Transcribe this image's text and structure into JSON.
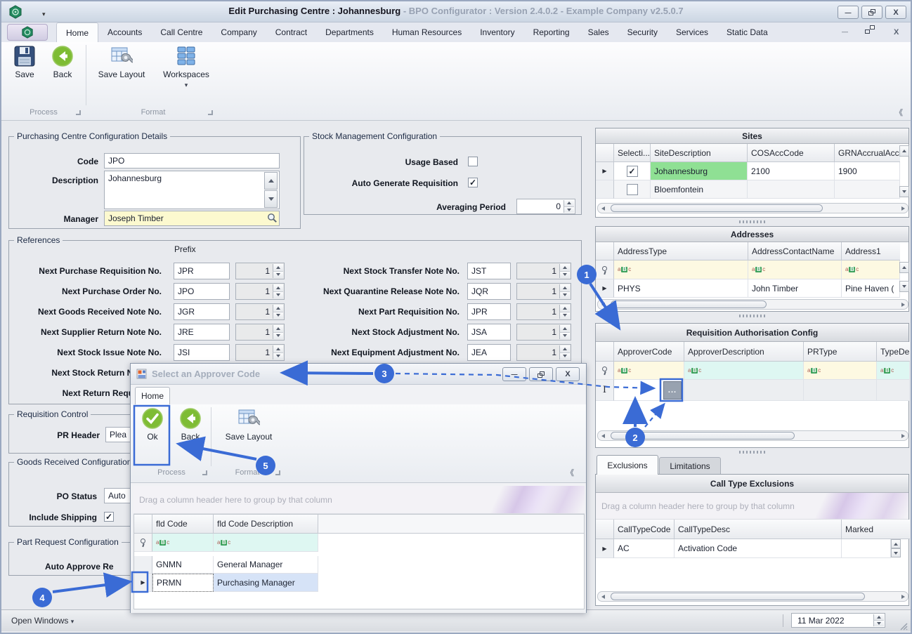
{
  "window": {
    "title": "Edit Purchasing Centre : Johannesburg",
    "subtitle": " - BPO Configurator : Version 2.4.0.2 - Example Company v2.5.0.7"
  },
  "ribbon": {
    "tabs": [
      "Home",
      "Accounts",
      "Call Centre",
      "Company",
      "Contract",
      "Departments",
      "Human Resources",
      "Inventory",
      "Reporting",
      "Sales",
      "Security",
      "Services",
      "Static Data"
    ],
    "save": "Save",
    "back": "Back",
    "save_layout": "Save Layout",
    "workspaces": "Workspaces",
    "group_process": "Process",
    "group_format": "Format"
  },
  "form": {
    "pcc": {
      "title": "Purchasing Centre Configuration Details",
      "code_label": "Code",
      "code": "JPO",
      "desc_label": "Description",
      "desc": "Johannesburg",
      "manager_label": "Manager",
      "manager": "Joseph Timber"
    },
    "stock": {
      "title": "Stock Management Configuration",
      "usage_label": "Usage Based",
      "usage_check": "",
      "autogen_label": "Auto Generate Requisition",
      "autogen_check": "✓",
      "avg_label": "Averaging Period",
      "avg": "0"
    },
    "refs": {
      "title": "References",
      "prefix": "Prefix",
      "l1": "Next Purchase Requisition No.",
      "l1p": "JPR",
      "l1n": "1",
      "l2": "Next Purchase Order No.",
      "l2p": "JPO",
      "l2n": "1",
      "l3": "Next Goods Received Note No.",
      "l3p": "JGR",
      "l3n": "1",
      "l4": "Next Supplier Return Note No.",
      "l4p": "JRE",
      "l4n": "1",
      "l5": "Next Stock Issue Note No.",
      "l5p": "JSI",
      "l5n": "1",
      "l6": "Next Stock Return Note No.",
      "l7": "Next Return Request No.",
      "r1": "Next Stock Transfer Note No.",
      "r1p": "JST",
      "r1n": "1",
      "r2": "Next Quarantine Release Note No.",
      "r2p": "JQR",
      "r2n": "1",
      "r3": "Next Part Requisition No.",
      "r3p": "JPR",
      "r3n": "1",
      "r4": "Next Stock Adjustment No.",
      "r4p": "JSA",
      "r4n": "1",
      "r5": "Next Equipment Adjustment No.",
      "r5p": "JEA",
      "r5n": "1"
    },
    "reqctl": {
      "title": "Requisition Control",
      "pr_label": "PR Header",
      "pr": "Plea"
    },
    "grc": {
      "title": "Goods Received Configuration",
      "po_label": "PO Status",
      "po": "Auto",
      "ship_label": "Include Shipping",
      "ship_check": "✓"
    },
    "prc": {
      "title": "Part Request Configuration",
      "auto_label": "Auto Approve Re"
    }
  },
  "sites": {
    "title": "Sites",
    "c1": "Selecti...",
    "c2": "SiteDescription",
    "c3": "COSAccCode",
    "c4": "GRNAccrualAccC",
    "r1_check": "✓",
    "r1_desc": "Johannesburg",
    "r1_cos": "2100",
    "r1_grn": "1900",
    "r2_check": "",
    "r2_desc": "Bloemfontein"
  },
  "addresses": {
    "title": "Addresses",
    "c1": "AddressType",
    "c2": "AddressContactName",
    "c3": "Address1",
    "r1_type": "PHYS",
    "r1_contact": "John Timber",
    "r1_addr": "Pine Haven ("
  },
  "req_auth": {
    "title": "Requisition Authorisation Config",
    "c1": "ApproverCode",
    "c2": "ApproverDescription",
    "c3": "PRType",
    "c4": "TypeDes",
    "ellipsis": "..."
  },
  "exclusions": {
    "tab1": "Exclusions",
    "tab2": "Limitations",
    "title": "Call Type Exclusions",
    "hint": "Drag a column header here to group by that column",
    "c1": "CallTypeCode",
    "c2": "CallTypeDesc",
    "c3": "Marked",
    "r1_code": "AC",
    "r1_desc": "Activation Code"
  },
  "dialog": {
    "title": "Select an Approver Code",
    "tab": "Home",
    "ok": "Ok",
    "back": "Back",
    "save_layout": "Save Layout",
    "group_process": "Process",
    "group_format": "Format",
    "hint": "Drag a column header here to group by that column",
    "c1": "fld Code",
    "c2": "fld Code Description",
    "r1_code": "GNMN",
    "r1_desc": "General Manager",
    "r2_code": "PRMN",
    "r2_desc": "Purchasing Manager"
  },
  "statusbar": {
    "open_windows": "Open Windows",
    "date": "11 Mar 2022"
  },
  "annotations": {
    "b1": "1",
    "b2": "2",
    "b3": "3",
    "b4": "4",
    "b5": "5"
  }
}
